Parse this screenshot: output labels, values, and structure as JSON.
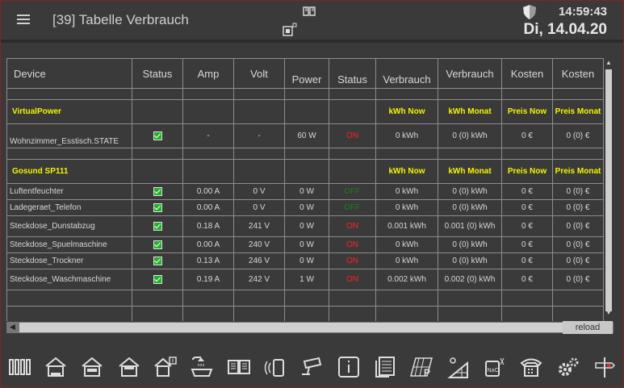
{
  "header": {
    "title": "[39] Tabelle Verbrauch",
    "time": "14:59:43",
    "date": "Di, 14.04.20"
  },
  "table": {
    "columns": [
      "Device",
      "Status",
      "Amp",
      "Volt",
      "Power",
      "Status",
      "Verbrauch",
      "Verbrauch",
      "Kosten",
      "Kosten"
    ],
    "sections": [
      {
        "name": "VirtualPower",
        "unit_now": "kWh Now",
        "unit_month": "kWh Monat",
        "price_now": "Preis Now",
        "price_month": "Preis Monat",
        "rows": [
          [
            "Wohnzimmer_Esstisch.STATE",
            "",
            "-",
            "-",
            "60 W",
            "ON",
            "0 kWh",
            "0 (0) kWh",
            "0 €",
            "0 (0) €"
          ]
        ]
      },
      {
        "name": "Gosund SP111",
        "unit_now": "kWh Now",
        "unit_month": "kWh Monat",
        "price_now": "Preis Now",
        "price_month": "Preis Monat",
        "rows": [
          [
            "Luftentfeuchter",
            "",
            "0.00 A",
            "0 V",
            "0 W",
            "OFF",
            "0 kWh",
            "0 (0) kWh",
            "0 €",
            "0 (0) €"
          ],
          [
            "Ladegeraet_Telefon",
            "",
            "0.00 A",
            "0 V",
            "0 W",
            "OFF",
            "0 kWh",
            "0 (0) kWh",
            "0 €",
            "0 (0) €"
          ],
          [
            "Steckdose_Dunstabzug",
            "",
            "0.18 A",
            "241 V",
            "0 W",
            "ON",
            "0.001 kWh",
            "0.001 (0) kWh",
            "0 €",
            "0 (0) €"
          ],
          [
            "Steckdose_Spuelmaschine",
            "",
            "0.00 A",
            "240 V",
            "0 W",
            "ON",
            "0 kWh",
            "0 (0) kWh",
            "0 €",
            "0 (0) €"
          ],
          [
            "Steckdose_Trockner",
            "",
            "0.13 A",
            "246 V",
            "0 W",
            "ON",
            "0 kWh",
            "0 (0) kWh",
            "0 €",
            "0 (0) €"
          ],
          [
            "Steckdose_Waschmaschine",
            "",
            "0.19 A",
            "242 V",
            "1 W",
            "ON",
            "0.002 kWh",
            "0.002 (0) kWh",
            "0 €",
            "0 (0) €"
          ]
        ]
      }
    ]
  },
  "reload_label": "reload",
  "footer": {
    "icons": [
      "radiator-icon",
      "house-kg-icon",
      "house-eg-icon",
      "house-og-icon",
      "house-info-icon",
      "shower-icon",
      "book-icon",
      "phone-speaker-icon",
      "camera-icon",
      "info-icon",
      "documents-icon",
      "solar-p-icon",
      "solar-panel-icon",
      "nacl-icon",
      "telephone-icon",
      "gears-icon",
      "signpost-icon"
    ]
  },
  "colors": {
    "accent_yellow": "#f5f500",
    "on_red": "#ff2020",
    "off_green": "#1e7a1e",
    "check_green": "#22b12c"
  }
}
